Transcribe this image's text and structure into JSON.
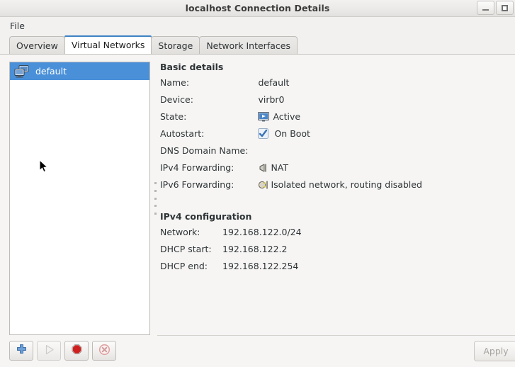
{
  "window": {
    "title": "localhost Connection Details",
    "controls": [
      {
        "name": "minimize-button",
        "label": "_"
      },
      {
        "name": "maximize-button",
        "label": "□"
      }
    ]
  },
  "menubar": {
    "items": [
      {
        "label": "File"
      }
    ]
  },
  "tabs": [
    {
      "label": "Overview",
      "active": false
    },
    {
      "label": "Virtual Networks",
      "active": true
    },
    {
      "label": "Storage",
      "active": false
    },
    {
      "label": "Network Interfaces",
      "active": false
    }
  ],
  "network_list": {
    "items": [
      {
        "label": "default",
        "icon": "network-computers-icon",
        "selected": true
      }
    ]
  },
  "details": {
    "basic_section_title": "Basic details",
    "rows": [
      {
        "label": "Name:",
        "value": "default",
        "icon": ""
      },
      {
        "label": "Device:",
        "value": "virbr0",
        "icon": ""
      },
      {
        "label": "State:",
        "value": "Active",
        "icon": "monitor-active-icon"
      },
      {
        "label": "Autostart:",
        "value": "On Boot",
        "icon": "checkbox-checked-icon"
      },
      {
        "label": "DNS Domain Name:",
        "value": "",
        "icon": ""
      },
      {
        "label": "IPv4 Forwarding:",
        "value": "NAT",
        "icon": "nat-forward-icon"
      },
      {
        "label": "IPv6 Forwarding:",
        "value": "Isolated network, routing disabled",
        "icon": "plug-isolated-icon"
      }
    ],
    "ipv4_section_title": "IPv4 configuration",
    "ipv4_rows": [
      {
        "label": "Network:",
        "value": "192.168.122.0/24"
      },
      {
        "label": "DHCP start:",
        "value": "192.168.122.2"
      },
      {
        "label": "DHCP end:",
        "value": "192.168.122.254"
      }
    ]
  },
  "footer": {
    "buttons": [
      {
        "name": "add-network-button",
        "icon": "plus-icon",
        "enabled": true
      },
      {
        "name": "start-network-button",
        "icon": "play-icon",
        "enabled": false
      },
      {
        "name": "stop-network-button",
        "icon": "stop-icon",
        "enabled": true
      },
      {
        "name": "delete-network-button",
        "icon": "delete-icon",
        "enabled": true
      }
    ],
    "apply_label": "Apply",
    "apply_enabled": false
  },
  "colors": {
    "selection": "#4a90d9",
    "tab_accent": "#3d83c4",
    "window_bg": "#f6f5f4",
    "stop_red": "#cc2222",
    "delete_red": "#d9a3a3"
  }
}
